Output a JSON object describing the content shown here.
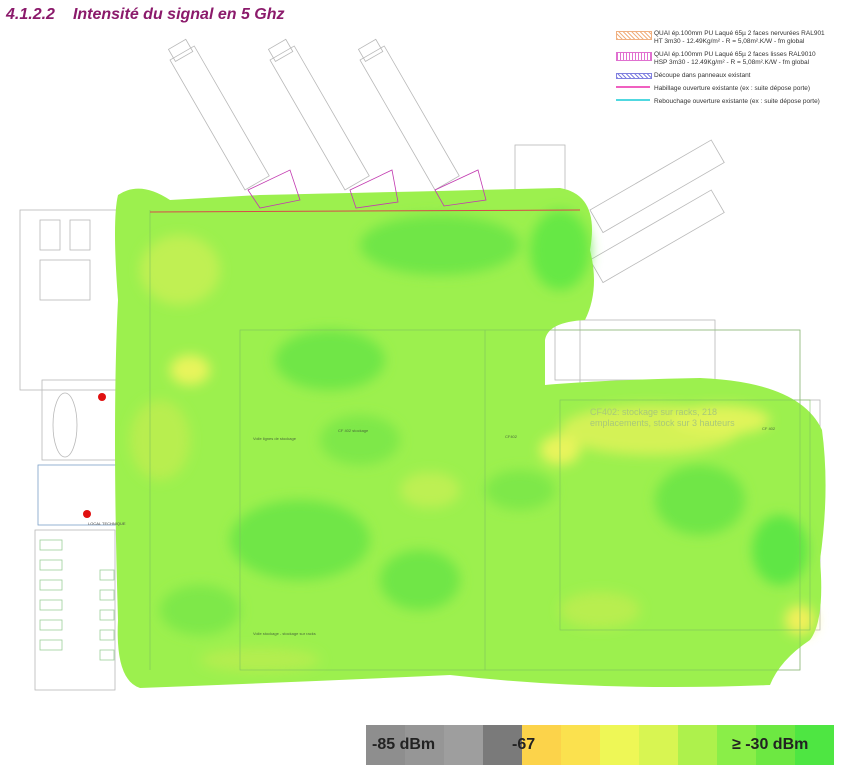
{
  "heading": {
    "number": "4.1.2.2",
    "title": "Intensité du signal en 5 Ghz"
  },
  "legend": [
    {
      "swatch": "orange-hatch",
      "line1": "QUAI ép.100mm PU Laqué 65µ 2 faces nervurées RAL901",
      "line2": "HT 3m30 - 12.49Kg/m² - R = 5,08m².K/W - fm global"
    },
    {
      "swatch": "pink-hatch",
      "line1": "QUAI ép.100mm PU Laqué 65µ 2 faces lisses RAL9010",
      "line2": "HSP 3m30 - 12.49Kg/m² - R = 5,08m².K/W - fm global"
    },
    {
      "swatch": "blue-hatch",
      "line1": "Découpe dans panneaux existant",
      "line2": ""
    },
    {
      "swatch": "pink-line",
      "line1": "Habillage ouverture existante (ex : suite dépose porte)",
      "line2": ""
    },
    {
      "swatch": "cyan-line",
      "line1": "Rebouchage ouverture existante (ex : suite dépose porte)",
      "line2": ""
    }
  ],
  "map": {
    "zone_label_line1": "CF402: stockage sur racks, 218",
    "zone_label_line2": "emplacements, stock sur 3 hauteurs",
    "small_labels": [
      "Voile lignes de stockage",
      "CF 402 stockage",
      "CF402",
      "CF 402",
      "Voile stockage - stockage sur racks",
      "LOCAL TECHNIQUE"
    ],
    "access_points": 2
  },
  "scale": {
    "min_label": "-85 dBm",
    "mid_label": "-67",
    "max_label": "≥ -30 dBm",
    "colors": [
      "#8e8e8e",
      "#969696",
      "#9e9e9e",
      "#7a7a7a",
      "#fcd34a",
      "#fbe14e",
      "#eef756",
      "#d8f552",
      "#aef14c",
      "#8aee48",
      "#6de842",
      "#4ee642"
    ]
  }
}
